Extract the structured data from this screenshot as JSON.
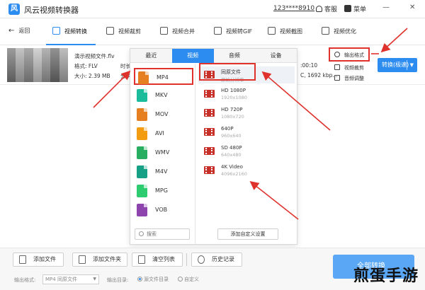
{
  "titlebar": {
    "app_title": "风云视频转换器",
    "user_id": "123****8910",
    "service_label": "客服",
    "menu_label": "菜单",
    "minimize": "—",
    "close": "✕"
  },
  "toolbar": {
    "back": "返回",
    "items": [
      {
        "label": "视频转换"
      },
      {
        "label": "视频裁剪"
      },
      {
        "label": "视频合并"
      },
      {
        "label": "视频转GIF"
      },
      {
        "label": "视频截图"
      },
      {
        "label": "视频优化"
      }
    ]
  },
  "file": {
    "name": "演示视频文件.flv",
    "format_label": "格式: FLV",
    "size_label": "大小: 2.39 MB",
    "format_label_2": "时长",
    "size_label_2": "分辨",
    "duration": ":00:10",
    "bitrate": "C, 1692 kbp..."
  },
  "side_actions": {
    "output_format": "输出格式",
    "video_crop": "视频裁剪",
    "music_adjust": "音频调整"
  },
  "convert_button": {
    "label": "转换(极速)",
    "caret": "▼"
  },
  "popup": {
    "tabs": [
      "最近",
      "视频",
      "音频",
      "设备"
    ],
    "active_tab": 1,
    "formats": [
      {
        "label": "MP4",
        "color": "#e67e22"
      },
      {
        "label": "MKV",
        "color": "#1abc9c"
      },
      {
        "label": "MOV",
        "color": "#e67e22"
      },
      {
        "label": "AVI",
        "color": "#f39c12"
      },
      {
        "label": "WMV",
        "color": "#27ae60"
      },
      {
        "label": "M4V",
        "color": "#16a085"
      },
      {
        "label": "MPG",
        "color": "#2ecc71"
      },
      {
        "label": "VOB",
        "color": "#8e44ad"
      }
    ],
    "search_placeholder": "搜索",
    "qualities": [
      {
        "name": "同原文件",
        "res": "原始分辨率"
      },
      {
        "name": "HD 1080P",
        "res": "1920x1080"
      },
      {
        "name": "HD 720P",
        "res": "1080x720"
      },
      {
        "name": "640P",
        "res": "960x640"
      },
      {
        "name": "SD 480P",
        "res": "640x480"
      },
      {
        "name": "4K Video",
        "res": "4096x2160"
      }
    ],
    "custom_button": "添加自定义设置"
  },
  "bottom": {
    "add_file": "添加文件",
    "add_folder": "添加文件夹",
    "clear_list": "清空列表",
    "history": "历史记录",
    "output_format_label": "输出格式:",
    "output_format_value": "MP4 同原文件",
    "output_dir_label": "输出目录:",
    "radio_source": "源文件目录",
    "radio_custom": "自定义",
    "convert_all": "全部转换"
  },
  "watermark": "煎蛋手游",
  "colors": {
    "accent": "#2d8cf0",
    "highlight": "#e0322d"
  }
}
